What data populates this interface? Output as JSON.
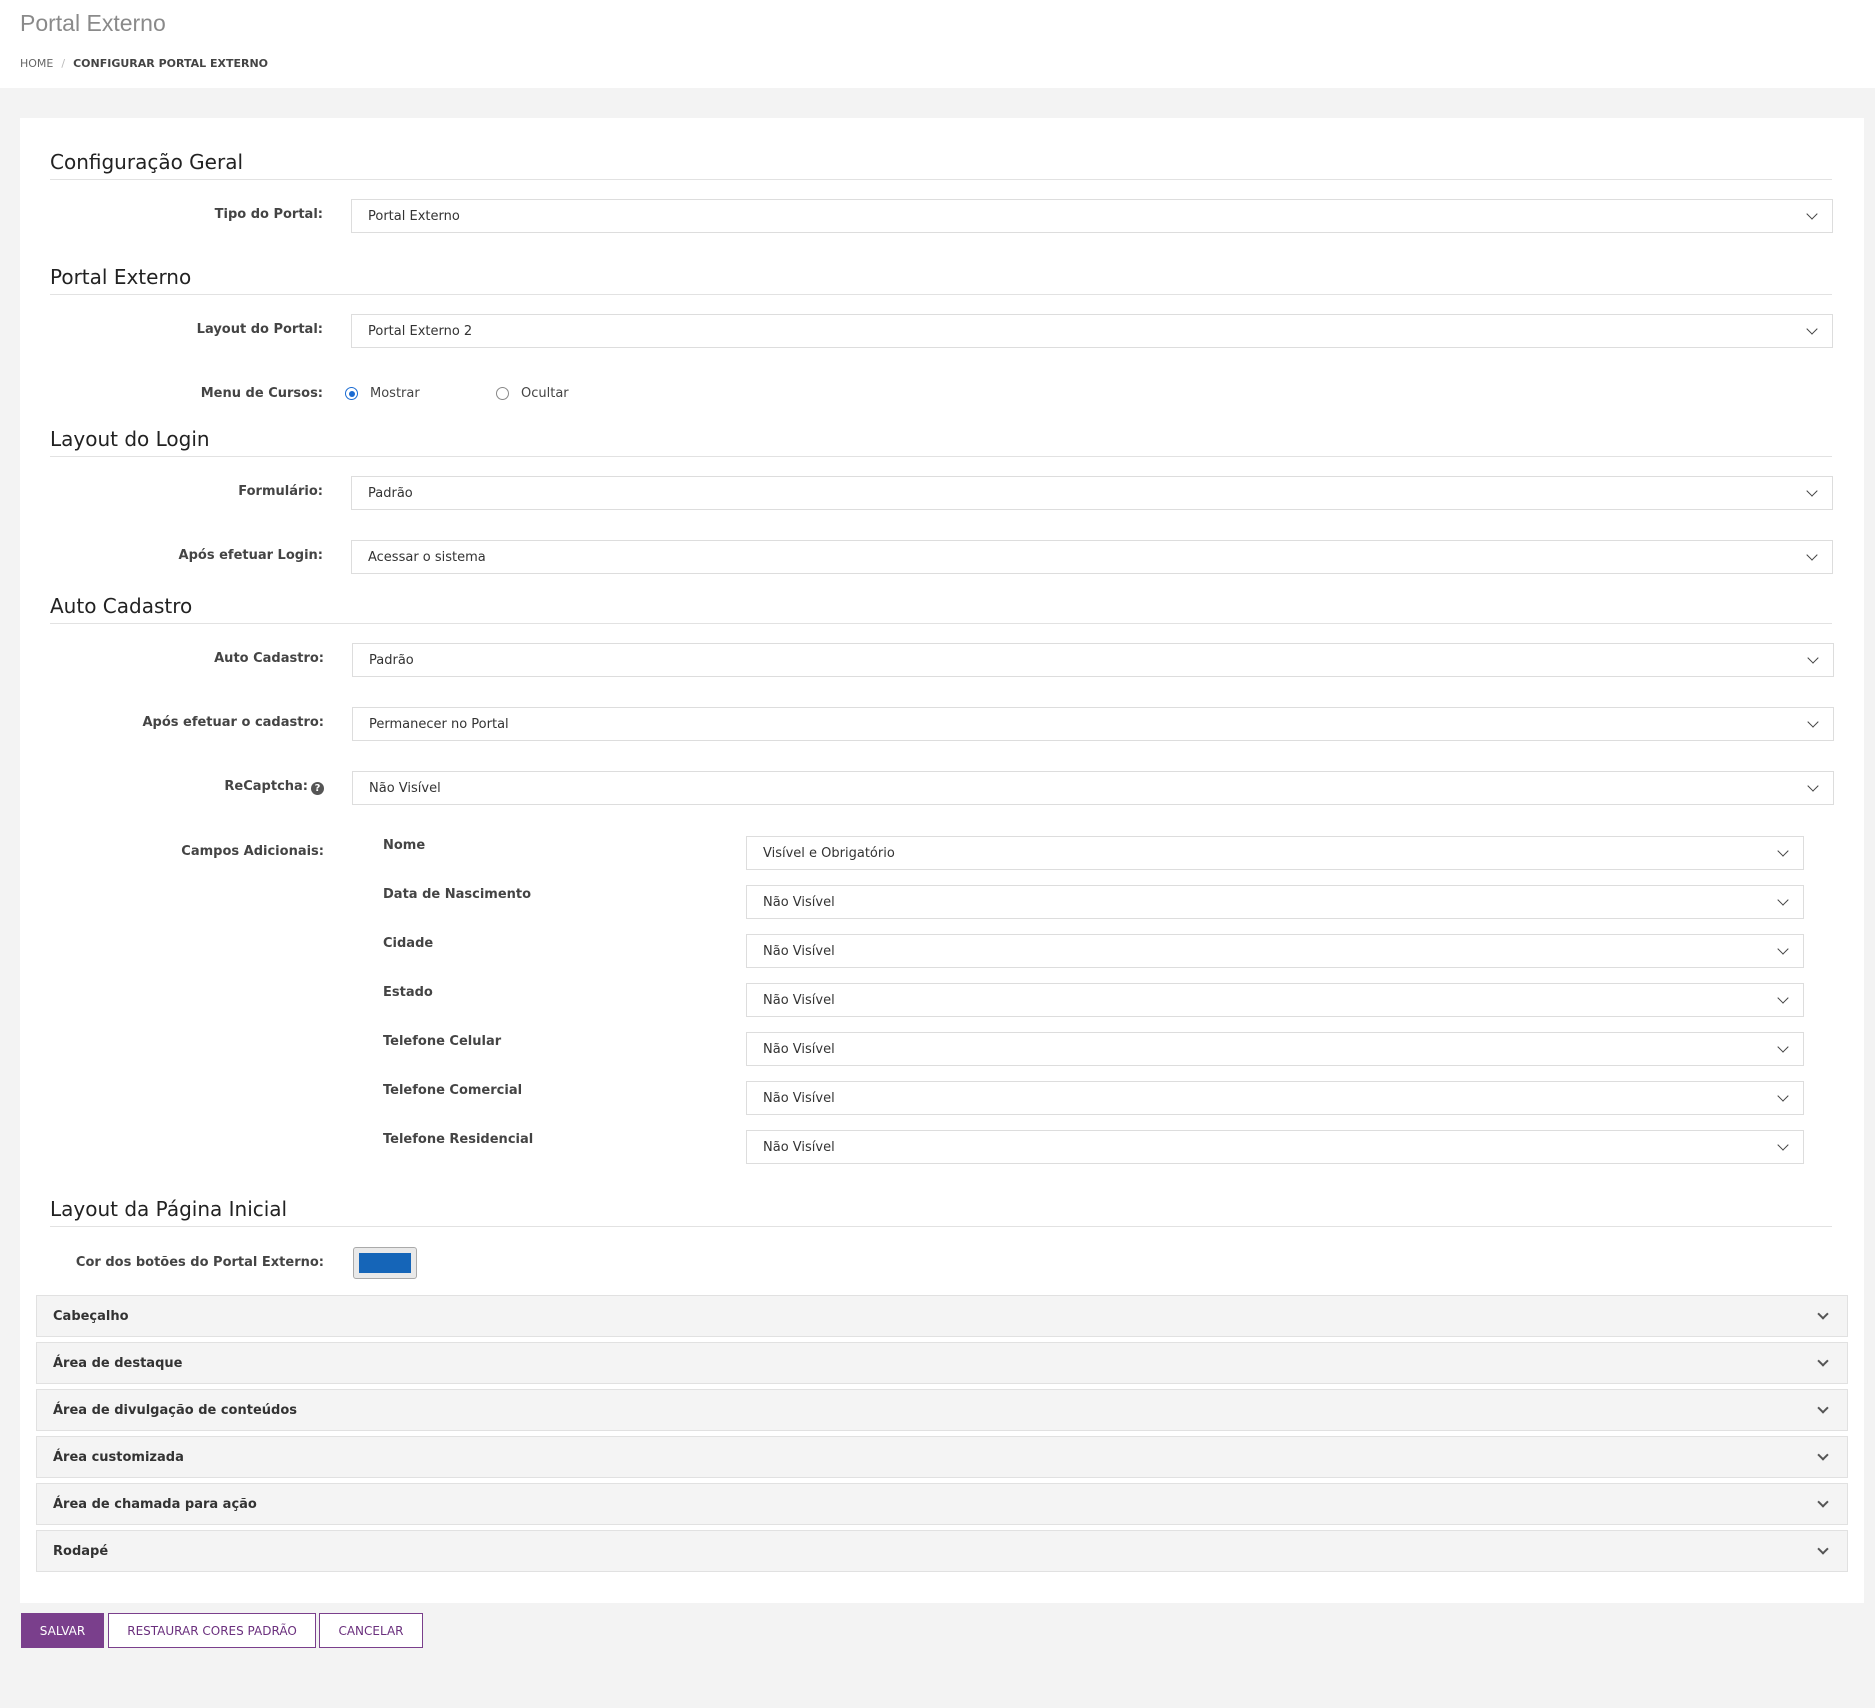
{
  "header": {
    "title": "Portal Externo",
    "breadcrumb": {
      "home": "HOME",
      "current": "CONFIGURAR PORTAL EXTERNO"
    }
  },
  "sections": {
    "geral": "Configuração Geral",
    "portal": "Portal Externo",
    "login": "Layout do Login",
    "cadastro": "Auto Cadastro",
    "inicial": "Layout da Página Inicial"
  },
  "fields": {
    "tipo_portal": {
      "label": "Tipo do Portal:",
      "value": "Portal Externo"
    },
    "layout_portal": {
      "label": "Layout do Portal:",
      "value": "Portal Externo 2"
    },
    "menu_cursos": {
      "label": "Menu de Cursos:",
      "option_show": "Mostrar",
      "option_hide": "Ocultar",
      "selected": "Mostrar"
    },
    "formulario": {
      "label": "Formulário:",
      "value": "Padrão"
    },
    "apos_login": {
      "label": "Após efetuar Login:",
      "value": "Acessar o sistema"
    },
    "auto_cadastro": {
      "label": "Auto Cadastro:",
      "value": "Padrão"
    },
    "apos_cadastro": {
      "label": "Após efetuar o cadastro:",
      "value": "Permanecer no Portal"
    },
    "recaptcha": {
      "label": "ReCaptcha:",
      "value": "Não Visível"
    },
    "campos_adicionais": {
      "label": "Campos Adicionais:",
      "items": [
        {
          "name": "Nome",
          "value": "Visível e Obrigatório"
        },
        {
          "name": "Data de Nascimento",
          "value": "Não Visível"
        },
        {
          "name": "Cidade",
          "value": "Não Visível"
        },
        {
          "name": "Estado",
          "value": "Não Visível"
        },
        {
          "name": "Telefone Celular",
          "value": "Não Visível"
        },
        {
          "name": "Telefone Comercial",
          "value": "Não Visível"
        },
        {
          "name": "Telefone Residencial",
          "value": "Não Visível"
        }
      ]
    },
    "cor_botoes": {
      "label": "Cor dos botões do Portal Externo:",
      "color": "#1565b8"
    }
  },
  "accordions": [
    "Cabeçalho",
    "Área de destaque",
    "Área de divulgação de conteúdos",
    "Área customizada",
    "Área de chamada para ação",
    "Rodapé"
  ],
  "buttons": {
    "save": "SALVAR",
    "restore": "RESTAURAR CORES PADRÃO",
    "cancel": "CANCELAR"
  },
  "colors": {
    "accent": "#7a3f8c",
    "radio": "#1a6bd2"
  }
}
